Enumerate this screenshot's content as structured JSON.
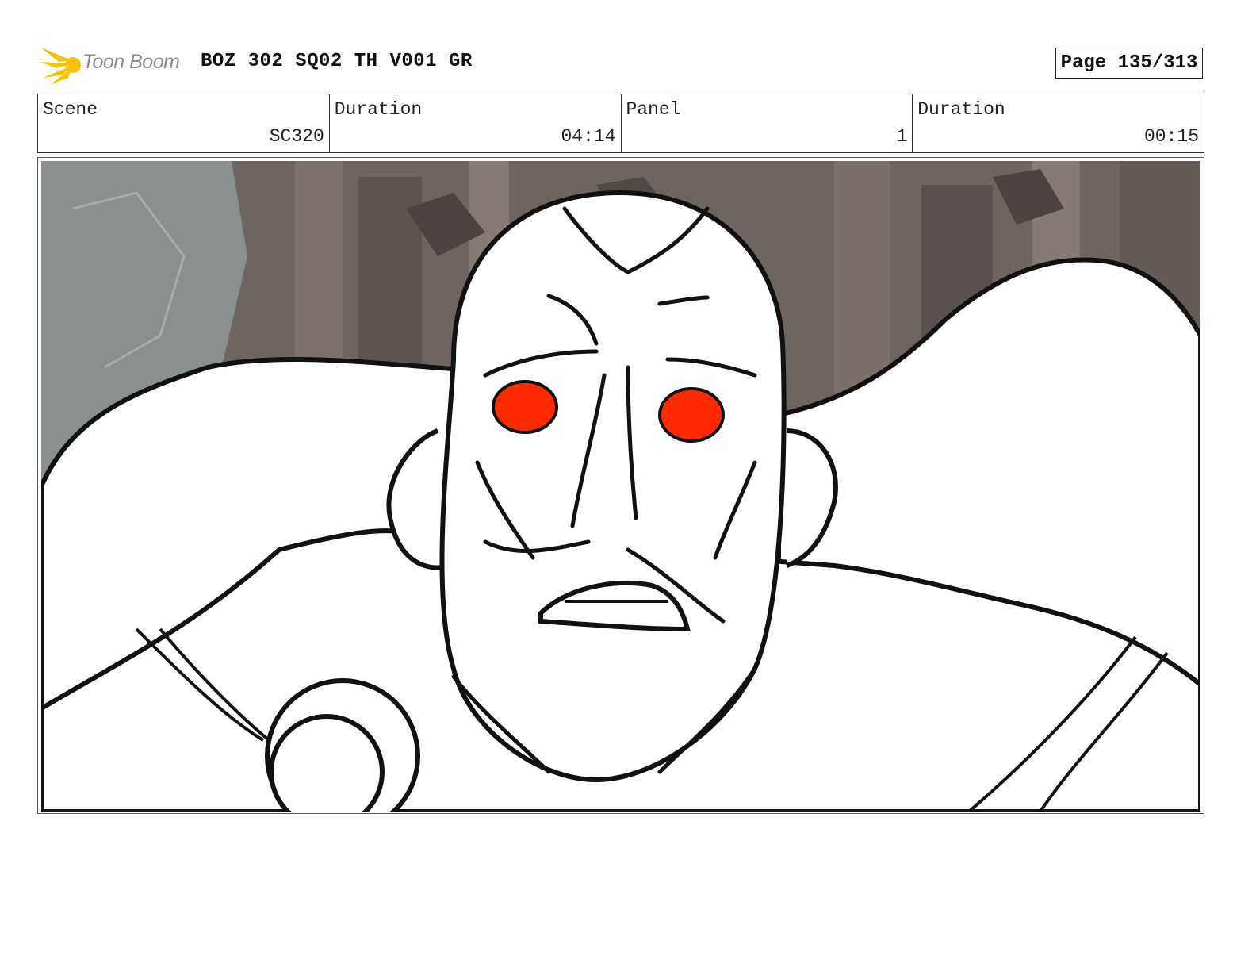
{
  "header": {
    "logo_text": "Toon Boom",
    "title": "BOZ 302 SQ02 TH V001 GR",
    "page": "Page 135/313"
  },
  "info": [
    {
      "label": "Scene",
      "value": "SC320"
    },
    {
      "label": "Duration",
      "value": "04:14"
    },
    {
      "label": "Panel",
      "value": "1"
    },
    {
      "label": "Duration",
      "value": "00:15"
    }
  ],
  "colors": {
    "eyes": "#ff2a00",
    "logo": "#f5c400",
    "background_rock": "#6f6560",
    "cliff": "#8a9090"
  },
  "icons": [
    "toon-boom-logo-icon"
  ]
}
